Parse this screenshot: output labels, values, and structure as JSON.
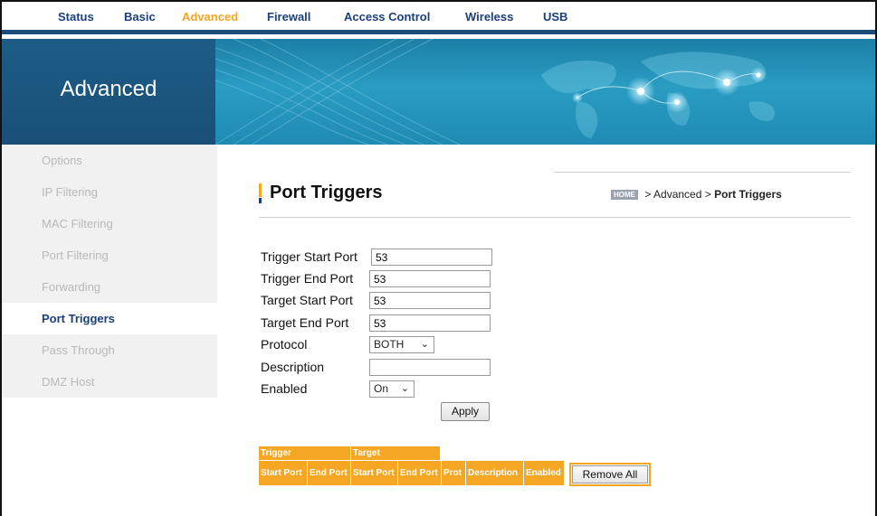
{
  "nav": {
    "items": [
      {
        "label": "Status"
      },
      {
        "label": "Basic"
      },
      {
        "label": "Advanced"
      },
      {
        "label": "Firewall"
      },
      {
        "label": "Access Control"
      },
      {
        "label": "Wireless"
      },
      {
        "label": "USB"
      }
    ],
    "active": "Advanced"
  },
  "banner": {
    "title": "Advanced"
  },
  "sidebar": {
    "items": [
      {
        "label": "Options"
      },
      {
        "label": "IP Filtering"
      },
      {
        "label": "MAC Filtering"
      },
      {
        "label": "Port Filtering"
      },
      {
        "label": "Forwarding"
      },
      {
        "label": "Port Triggers"
      },
      {
        "label": "Pass Through"
      },
      {
        "label": "DMZ Host"
      }
    ],
    "active": "Port Triggers"
  },
  "page": {
    "title": "Port Triggers",
    "breadcrumb": {
      "home": "HOME",
      "sep": ">",
      "section": "Advanced",
      "current": "Port Triggers"
    }
  },
  "form": {
    "trigger_start_port": {
      "label": "Trigger Start Port",
      "value": "53"
    },
    "trigger_end_port": {
      "label": "Trigger End Port",
      "value": "53"
    },
    "target_start_port": {
      "label": "Target Start Port",
      "value": "53"
    },
    "target_end_port": {
      "label": "Target End Port",
      "value": "53"
    },
    "protocol": {
      "label": "Protocol",
      "value": "BOTH"
    },
    "description": {
      "label": "Description",
      "value": ""
    },
    "enabled": {
      "label": "Enabled",
      "value": "On"
    },
    "apply_label": "Apply"
  },
  "table": {
    "group_headers": [
      "Trigger",
      "Target"
    ],
    "columns": [
      "Start Port",
      "End Port",
      "Start Port",
      "End Port",
      "Prot",
      "Description",
      "Enabled"
    ],
    "remove_all_label": "Remove All"
  },
  "colors": {
    "accent": "#f5a623",
    "nav_text": "#1b3f7a",
    "banner_dark": "#1a4f78",
    "banner": "#2a9cc2"
  }
}
